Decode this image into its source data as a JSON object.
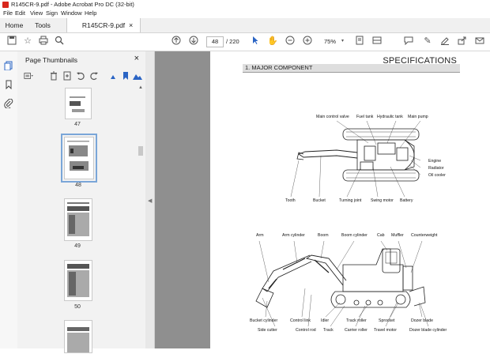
{
  "window": {
    "title": "R145CR-9.pdf - Adobe Acrobat Pro DC (32-bit)"
  },
  "menu": [
    "File",
    "Edit",
    "View",
    "Sign",
    "Window",
    "Help"
  ],
  "tabs": {
    "home": "Home",
    "tools": "Tools",
    "document": "R145CR-9.pdf"
  },
  "toolbar": {
    "page_current": "48",
    "page_total": "/ 220",
    "zoom": "75%"
  },
  "thumbnails": {
    "header": "Page Thumbnails",
    "labels": [
      "47",
      "48",
      "49",
      "50"
    ],
    "selected": "48"
  },
  "page": {
    "title": "SPECIFICATIONS",
    "section": "1. MAJOR COMPONENT",
    "top_labels": {
      "main_control_valve": "Main control valve",
      "fuel_tank": "Fuel tank",
      "hydraulic_tank": "Hydraulic tank",
      "main_pump": "Main pump",
      "engine": "Engine",
      "radiator": "Radiator",
      "oil_cooler": "Oil cooler",
      "tooth": "Tooth",
      "bucket": "Bucket",
      "turning_joint": "Turning joint",
      "swing_motor": "Swing motor",
      "battery": "Battery"
    },
    "side_labels": {
      "arm": "Arm",
      "arm_cylinder": "Arm cylinder",
      "boom": "Boom",
      "boom_cylinder": "Boom cylinder",
      "cab": "Cab",
      "muffler": "Muffler",
      "counterweight": "Counterweight",
      "bucket_cylinder": "Bucket cylinder",
      "control_link": "Control link",
      "idler": "Idler",
      "track_roller": "Track roller",
      "sprocket": "Sprocket",
      "dozer_blade": "Dozer blade",
      "side_cutter": "Side cutter",
      "control_rod": "Control rod",
      "track": "Track",
      "carrier_roller": "Carrier roller",
      "travel_motor": "Travel motor",
      "dozer_blade_cylinder": "Dozer blade cylinder"
    }
  }
}
